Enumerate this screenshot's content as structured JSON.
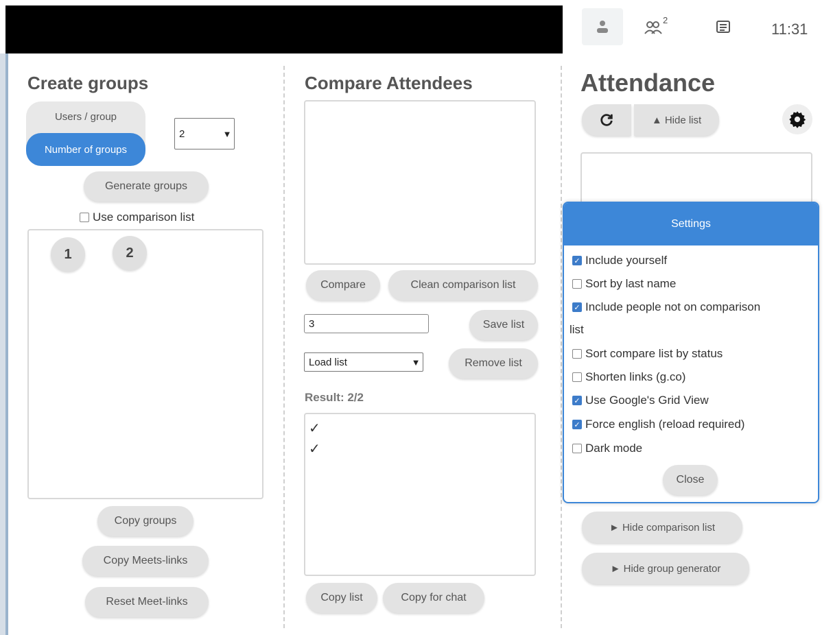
{
  "topbar": {
    "people_count": "2",
    "time": "11:31"
  },
  "create_groups": {
    "title": "Create groups",
    "mode_users_label": "Users / group",
    "mode_groups_label": "Number of groups",
    "count_value": "2",
    "generate_label": "Generate groups",
    "use_comparison_label": "Use comparison list",
    "use_comparison_checked": false,
    "groups": [
      "1",
      "2"
    ],
    "copy_groups_label": "Copy groups",
    "copy_meets_label": "Copy Meets-links",
    "reset_meet_label": "Reset Meet-links"
  },
  "compare": {
    "title": "Compare Attendees",
    "compare_label": "Compare",
    "clean_label": "Clean comparison list",
    "list_name_value": "3",
    "save_label": "Save list",
    "load_select_value": "Load list",
    "remove_label": "Remove list",
    "result_label": "Result: 2/2",
    "result_marks": [
      "✓",
      "✓"
    ],
    "copy_list_label": "Copy list",
    "copy_chat_label": "Copy for chat"
  },
  "attendance": {
    "title": "Attendance",
    "hide_list_label": "▲ Hide list",
    "hide_comparison_label": "► Hide comparison list",
    "hide_generator_label": "► Hide group generator"
  },
  "settings": {
    "title": "Settings",
    "options": [
      {
        "label": "Include yourself",
        "checked": true
      },
      {
        "label": "Sort by last name",
        "checked": false
      },
      {
        "label": "Include people not on comparison",
        "label_cont": "list",
        "checked": true
      },
      {
        "label": "Sort compare list by status",
        "checked": false
      },
      {
        "label": "Shorten links (g.co)",
        "checked": false
      },
      {
        "label": "Use Google's Grid View",
        "checked": true
      },
      {
        "label": "Force english (reload required)",
        "checked": true
      },
      {
        "label": "Dark mode",
        "checked": false
      }
    ],
    "close_label": "Close"
  },
  "colors": {
    "accent": "#3d87d8",
    "checkbox_on": "#3d7cc9",
    "pill_bg": "#e3e3e3"
  },
  "icons": [
    "person-icon",
    "people-icon",
    "chat-icon",
    "refresh-icon",
    "gear-icon"
  ]
}
